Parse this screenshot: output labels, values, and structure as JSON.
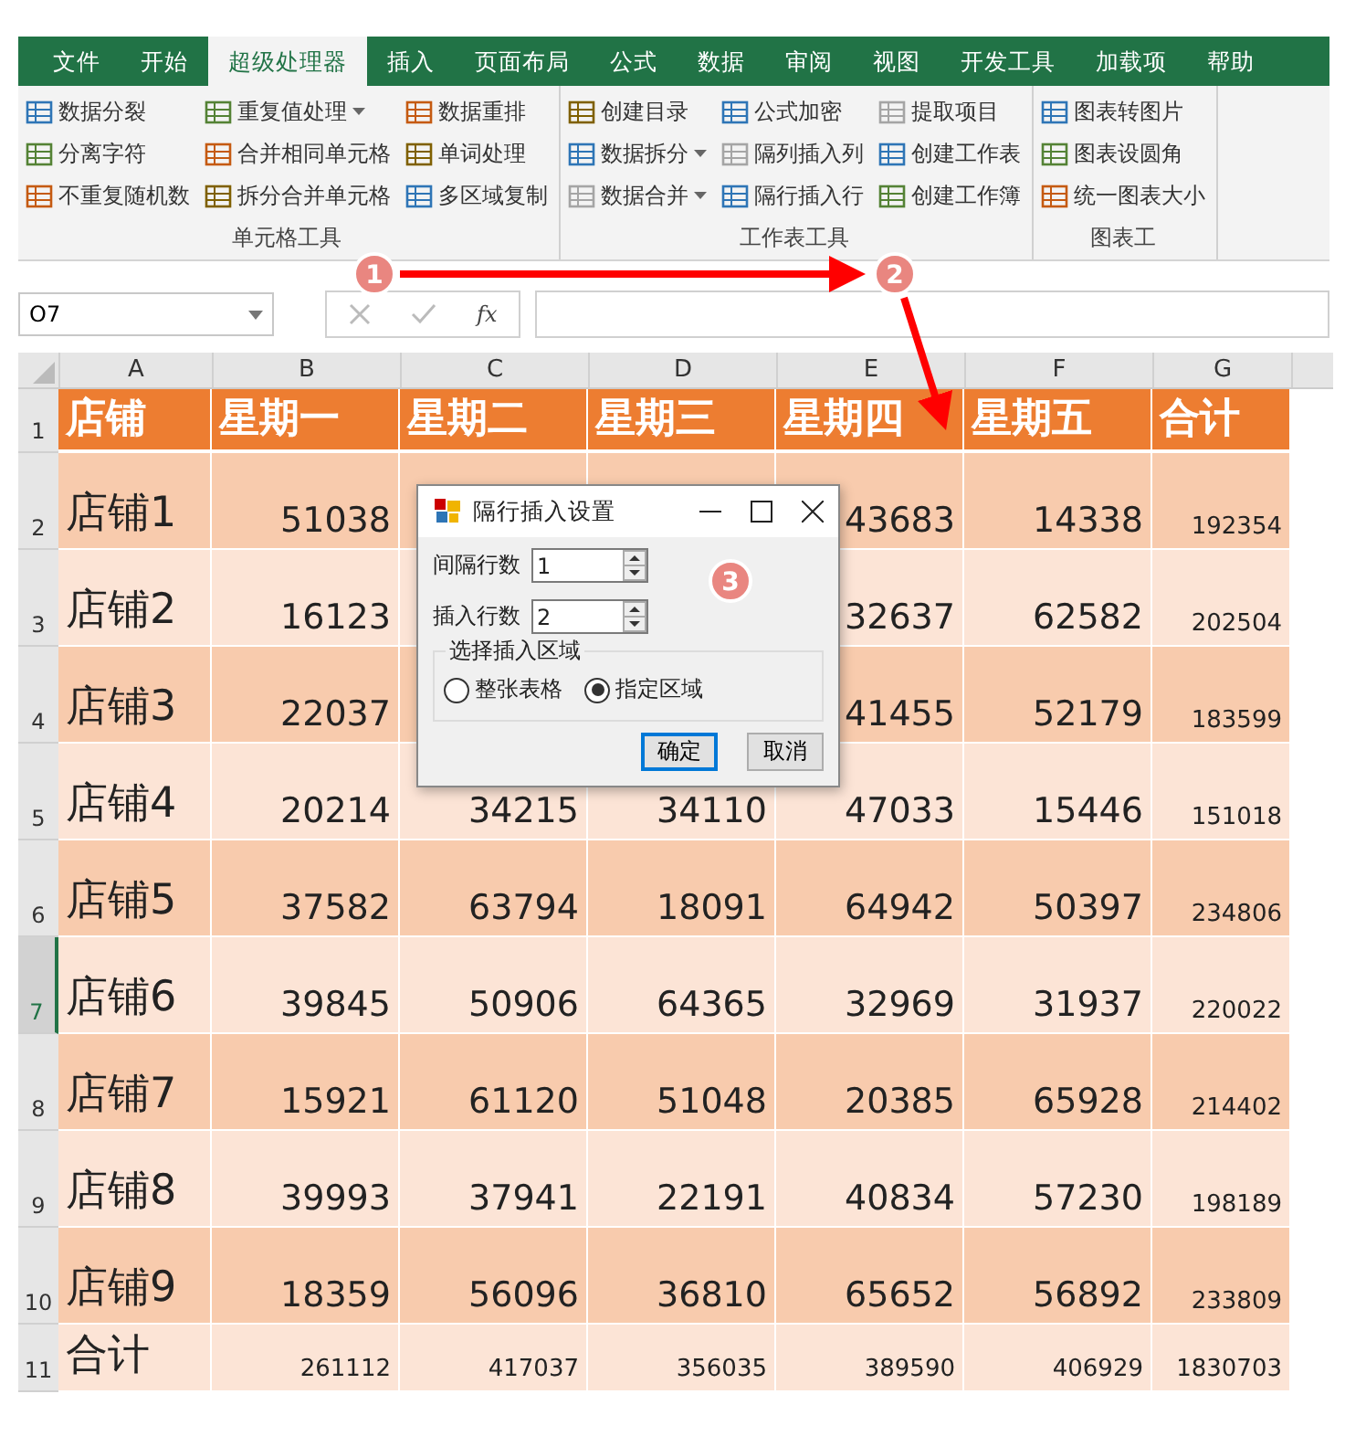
{
  "ribbon_tabs": [
    {
      "label": "文件",
      "selected": false
    },
    {
      "label": "开始",
      "selected": false
    },
    {
      "label": "超级处理器",
      "selected": true
    },
    {
      "label": "插入",
      "selected": false
    },
    {
      "label": "页面布局",
      "selected": false
    },
    {
      "label": "公式",
      "selected": false
    },
    {
      "label": "数据",
      "selected": false
    },
    {
      "label": "审阅",
      "selected": false
    },
    {
      "label": "视图",
      "selected": false
    },
    {
      "label": "开发工具",
      "selected": false
    },
    {
      "label": "加载项",
      "selected": false
    },
    {
      "label": "帮助",
      "selected": false
    }
  ],
  "ribbon_groups": [
    {
      "label": "单元格工具",
      "columns": [
        [
          {
            "label": "数据分裂",
            "dropdown": false
          },
          {
            "label": "分离字符",
            "dropdown": false
          },
          {
            "label": "不重复随机数",
            "dropdown": false
          }
        ],
        [
          {
            "label": "重复值处理",
            "dropdown": true
          },
          {
            "label": "合并相同单元格",
            "dropdown": false
          },
          {
            "label": "拆分合并单元格",
            "dropdown": false
          }
        ],
        [
          {
            "label": "数据重排",
            "dropdown": false
          },
          {
            "label": "单词处理",
            "dropdown": false
          },
          {
            "label": "多区域复制",
            "dropdown": false
          }
        ]
      ]
    },
    {
      "label": "工作表工具",
      "columns": [
        [
          {
            "label": "创建目录",
            "dropdown": false
          },
          {
            "label": "数据拆分",
            "dropdown": true
          },
          {
            "label": "数据合并",
            "dropdown": true
          }
        ],
        [
          {
            "label": "公式加密",
            "dropdown": false
          },
          {
            "label": "隔列插入列",
            "dropdown": false
          },
          {
            "label": "隔行插入行",
            "dropdown": false
          }
        ],
        [
          {
            "label": "提取项目",
            "dropdown": false
          },
          {
            "label": "创建工作表",
            "dropdown": false
          },
          {
            "label": "创建工作簿",
            "dropdown": false
          }
        ]
      ]
    },
    {
      "label": "图表工",
      "columns": [
        [
          {
            "label": "图表转图片",
            "dropdown": false
          },
          {
            "label": "图表设圆角",
            "dropdown": false
          },
          {
            "label": "统一图表大小",
            "dropdown": false
          }
        ]
      ]
    }
  ],
  "formula_bar": {
    "name_box": "O7",
    "function_button": "fx"
  },
  "columns": [
    "A",
    "B",
    "C",
    "D",
    "E",
    "F",
    "G"
  ],
  "rows": [
    {
      "number": "1",
      "kind": "header",
      "selected": false,
      "cells": [
        "店铺",
        "星期一",
        "星期二",
        "星期三",
        "星期四",
        "星期五",
        "合计"
      ]
    },
    {
      "number": "2",
      "kind": "data",
      "selected": false,
      "cells": [
        "店铺1",
        "51038",
        null,
        null,
        "43683",
        "14338",
        "192354"
      ]
    },
    {
      "number": "3",
      "kind": "data",
      "selected": false,
      "cells": [
        "店铺2",
        "16123",
        null,
        null,
        "32637",
        "62582",
        "202504"
      ]
    },
    {
      "number": "4",
      "kind": "data",
      "selected": false,
      "cells": [
        "店铺3",
        "22037",
        null,
        null,
        "41455",
        "52179",
        "183599"
      ]
    },
    {
      "number": "5",
      "kind": "data",
      "selected": false,
      "cells": [
        "店铺4",
        "20214",
        "34215",
        "34110",
        "47033",
        "15446",
        "151018"
      ]
    },
    {
      "number": "6",
      "kind": "data",
      "selected": false,
      "cells": [
        "店铺5",
        "37582",
        "63794",
        "18091",
        "64942",
        "50397",
        "234806"
      ]
    },
    {
      "number": "7",
      "kind": "data",
      "selected": true,
      "cells": [
        "店铺6",
        "39845",
        "50906",
        "64365",
        "32969",
        "31937",
        "220022"
      ]
    },
    {
      "number": "8",
      "kind": "data",
      "selected": false,
      "cells": [
        "店铺7",
        "15921",
        "61120",
        "51048",
        "20385",
        "65928",
        "214402"
      ]
    },
    {
      "number": "9",
      "kind": "data",
      "selected": false,
      "cells": [
        "店铺8",
        "39993",
        "37941",
        "22191",
        "40834",
        "57230",
        "198189"
      ]
    },
    {
      "number": "10",
      "kind": "data",
      "selected": false,
      "cells": [
        "店铺9",
        "18359",
        "56096",
        "36810",
        "65652",
        "56892",
        "233809"
      ]
    },
    {
      "number": "11",
      "kind": "total",
      "selected": false,
      "cells": [
        "合计",
        "261112",
        "417037",
        "356035",
        "389590",
        "406929",
        "1830703"
      ]
    }
  ],
  "dialog": {
    "title": "隔行插入设置",
    "fields": [
      {
        "label": "间隔行数",
        "value": "1"
      },
      {
        "label": "插入行数",
        "value": "2"
      }
    ],
    "group_label": "选择插入区域",
    "radios": [
      {
        "label": "整张表格",
        "selected": false
      },
      {
        "label": "指定区域",
        "selected": true
      }
    ],
    "buttons": [
      {
        "label": "确定",
        "default": true
      },
      {
        "label": "取消",
        "default": false
      }
    ]
  },
  "callouts": [
    "1",
    "2",
    "3"
  ]
}
